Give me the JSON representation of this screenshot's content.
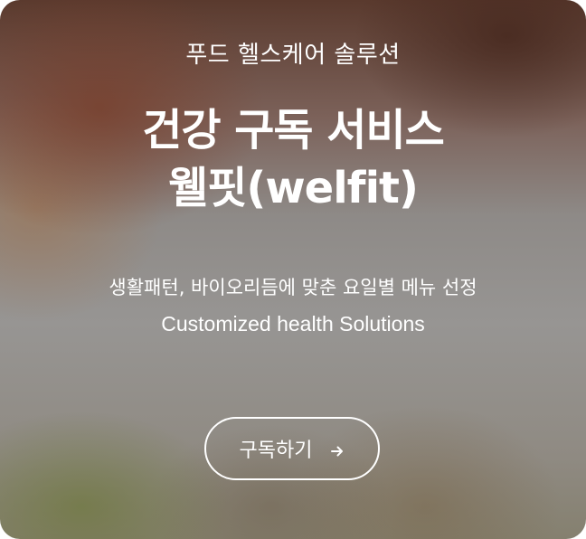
{
  "hero": {
    "eyebrow": "푸드 헬스케어 솔루션",
    "headline_line1": "건강 구독 서비스",
    "headline_line2": "웰핏(welfit)",
    "subtitle_ko": "생활패턴, 바이오리듬에 맞춘 요일별 메뉴 선정",
    "subtitle_en": "Customized health Solutions",
    "cta_label": "구독하기",
    "cta_icon": "arrow-right-icon"
  }
}
